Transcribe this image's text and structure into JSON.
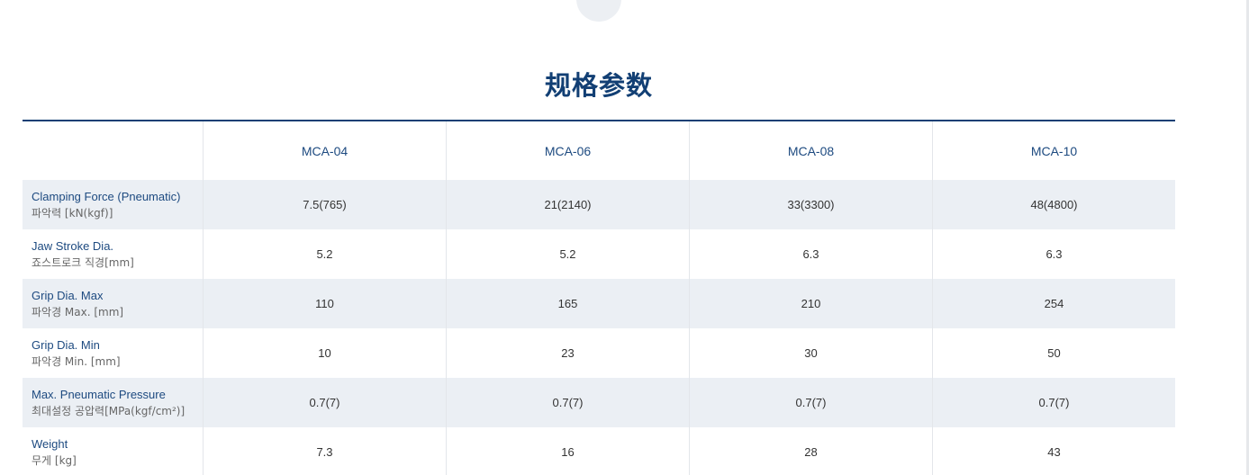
{
  "page": {
    "title": "规格参数"
  },
  "table": {
    "header": {
      "blank": "",
      "models": [
        "MCA-04",
        "MCA-06",
        "MCA-08",
        "MCA-10"
      ]
    },
    "rows": [
      {
        "label_en": "Clamping Force (Pneumatic)",
        "label_ko": "파악력 [kN(kgf)]",
        "values": [
          "7.5(765)",
          "21(2140)",
          "33(3300)",
          "48(4800)"
        ]
      },
      {
        "label_en": "Jaw Stroke Dia.",
        "label_ko": "죠스트로크 직경[mm]",
        "values": [
          "5.2",
          "5.2",
          "6.3",
          "6.3"
        ]
      },
      {
        "label_en": "Grip Dia. Max",
        "label_ko": "파악경 Max. [mm]",
        "values": [
          "110",
          "165",
          "210",
          "254"
        ]
      },
      {
        "label_en": "Grip Dia. Min",
        "label_ko": "파악경 Min. [mm]",
        "values": [
          "10",
          "23",
          "30",
          "50"
        ]
      },
      {
        "label_en": "Max. Pneumatic Pressure",
        "label_ko": "최대설정 공압력[MPa(kgf/cm²)]",
        "values": [
          "0.7(7)",
          "0.7(7)",
          "0.7(7)",
          "0.7(7)"
        ]
      },
      {
        "label_en": "Weight",
        "label_ko": "무게 [kg]",
        "values": [
          "7.3",
          "16",
          "28",
          "43"
        ]
      }
    ]
  },
  "colors": {
    "accent": "#123f74",
    "shade": "#ebeff4"
  }
}
